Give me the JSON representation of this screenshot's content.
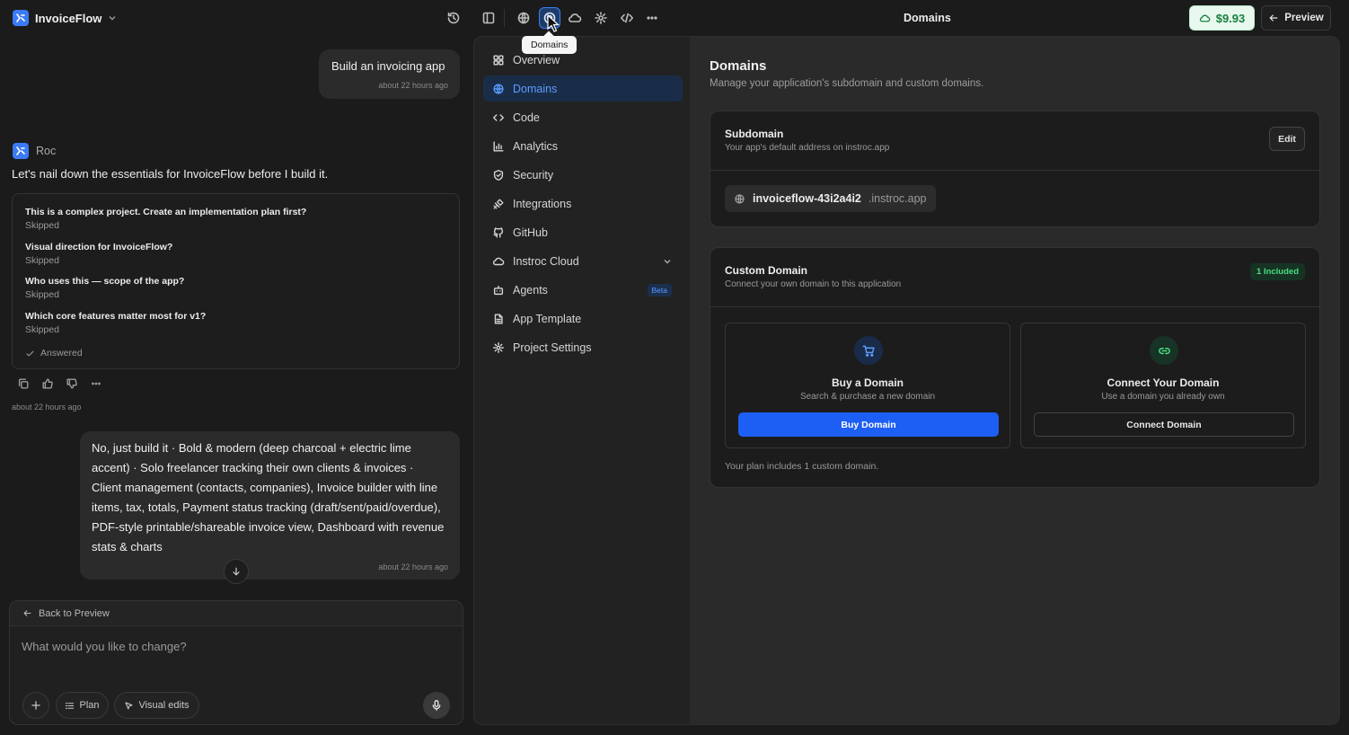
{
  "app": {
    "name": "InvoiceFlow"
  },
  "toolbar": {
    "tooltip": "Domains",
    "page_title": "Domains",
    "credits": "$9.93",
    "preview_label": "Preview"
  },
  "chat": {
    "user_msg_1": {
      "text": "Build an invoicing app",
      "time": "about 22 hours ago"
    },
    "agent": {
      "name": "Roc",
      "intro": "Let's nail down the essentials for InvoiceFlow before I build it."
    },
    "questions": [
      {
        "q": "This is a complex project. Create an implementation plan first?",
        "status": "Skipped"
      },
      {
        "q": "Visual direction for InvoiceFlow?",
        "status": "Skipped"
      },
      {
        "q": "Who uses this — scope of the app?",
        "status": "Skipped"
      },
      {
        "q": "Which core features matter most for v1?",
        "status": "Skipped"
      }
    ],
    "answered_label": "Answered",
    "agent_time": "about 22 hours ago",
    "user_msg_2": {
      "text": "No, just build it · Bold & modern (deep charcoal + electric lime accent) · Solo freelancer tracking their own clients & invoices · Client management (contacts, companies), Invoice builder with line items, tax, totals, Payment status tracking (draft/sent/paid/overdue), PDF-style printable/shareable invoice view, Dashboard with revenue stats & charts",
      "time": "about 22 hours ago"
    },
    "back_label": "Back to Preview",
    "input_placeholder": "What would you like to change?",
    "plan_label": "Plan",
    "visual_edits_label": "Visual edits"
  },
  "nav": {
    "items": [
      {
        "label": "Overview"
      },
      {
        "label": "Domains"
      },
      {
        "label": "Code"
      },
      {
        "label": "Analytics"
      },
      {
        "label": "Security"
      },
      {
        "label": "Integrations"
      },
      {
        "label": "GitHub"
      },
      {
        "label": "Instroc Cloud"
      },
      {
        "label": "Agents",
        "badge": "Beta"
      },
      {
        "label": "App Template"
      },
      {
        "label": "Project Settings"
      }
    ]
  },
  "domains": {
    "title": "Domains",
    "subtitle": "Manage your application's subdomain and custom domains.",
    "subdomain": {
      "title": "Subdomain",
      "desc": "Your app's default address on instroc.app",
      "edit_label": "Edit",
      "name": "invoiceflow-43i2a4i2",
      "suffix": ".instroc.app"
    },
    "custom": {
      "title": "Custom Domain",
      "desc": "Connect your own domain to this application",
      "badge": "1 Included",
      "buy": {
        "title": "Buy a Domain",
        "desc": "Search & purchase a new domain",
        "button": "Buy Domain"
      },
      "connect": {
        "title": "Connect Your Domain",
        "desc": "Use a domain you already own",
        "button": "Connect Domain"
      },
      "footer": "Your plan includes 1 custom domain."
    }
  },
  "colors": {
    "accent": "#1d5ef5",
    "active_nav": "#5b9bff",
    "credits_green": "#15803d",
    "included_green": "#4ade80"
  },
  "icons": {
    "toolbar": [
      "history-icon",
      "sidebar-icon",
      "globe-icon",
      "domains-icon",
      "cloud-icon",
      "settings-icon",
      "code-icon",
      "more-icon"
    ],
    "nav": [
      "overview-icon",
      "globe-icon",
      "code-icon",
      "analytics-icon",
      "shield-icon",
      "integrations-icon",
      "github-icon",
      "cloud-icon",
      "agents-icon",
      "template-icon",
      "gear-icon"
    ]
  }
}
